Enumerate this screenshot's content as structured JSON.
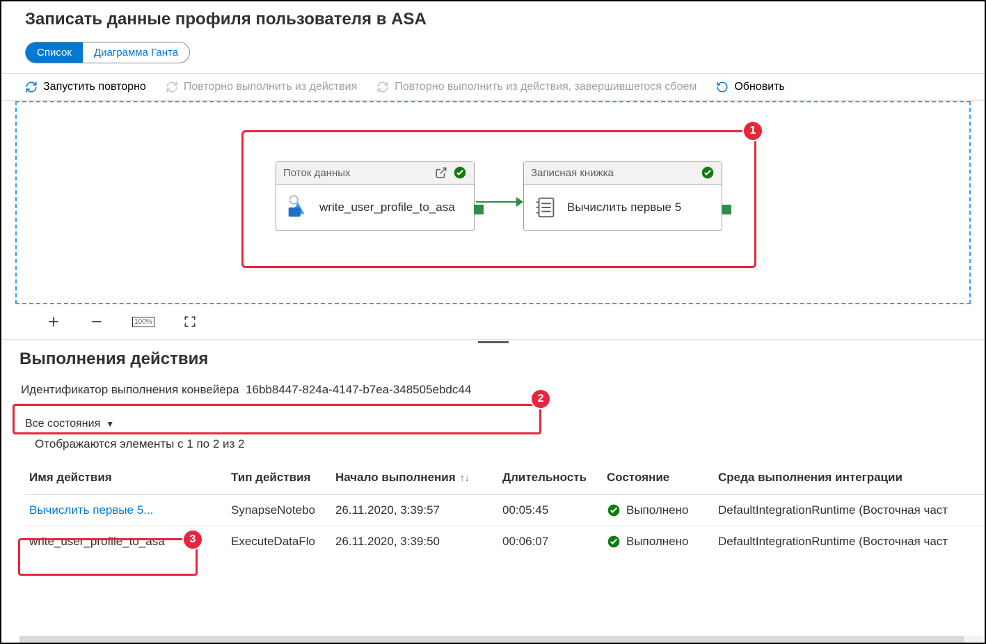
{
  "page_title": "Записать данные профиля пользователя в ASA",
  "view_toggle": {
    "list": "Список",
    "gantt": "Диаграмма Ганта"
  },
  "toolbar": {
    "rerun": "Запустить повторно",
    "rerun_from": "Повторно выполнить из действия",
    "rerun_from_failed": "Повторно выполнить из действия, завершившегося сбоем",
    "refresh": "Обновить"
  },
  "canvas": {
    "node1": {
      "header": "Поток данных",
      "label": "write_user_profile_to_asa"
    },
    "node2": {
      "header": "Записная книжка",
      "label": "Вычислить первые 5"
    }
  },
  "section_title": "Выполнения действия",
  "run_id_label": "Идентификатор выполнения конвейера",
  "run_id_value": "16bb8447-824a-4147-b7ea-348505ebdc44",
  "filter_label": "Все состояния",
  "count_text": "Отображаются элементы с 1 по 2 из 2",
  "columns": {
    "name": "Имя действия",
    "type": "Тип действия",
    "start": "Начало выполнения",
    "duration": "Длительность",
    "status": "Состояние",
    "ir": "Среда выполнения интеграции"
  },
  "status_done": "Выполнено",
  "rows": [
    {
      "name": "Вычислить первые 5...",
      "type": "SynapseNotebo",
      "start": "26.11.2020, 3:39:57",
      "duration": "00:05:45",
      "status": "Выполнено",
      "ir": "DefaultIntegrationRuntime (Восточная част"
    },
    {
      "name": "write_user_profile_to_asa",
      "type": "ExecuteDataFlo",
      "start": "26.11.2020, 3:39:50",
      "duration": "00:06:07",
      "status": "Выполнено",
      "ir": "DefaultIntegrationRuntime (Восточная част"
    }
  ],
  "badges": {
    "b1": "1",
    "b2": "2",
    "b3": "3"
  }
}
